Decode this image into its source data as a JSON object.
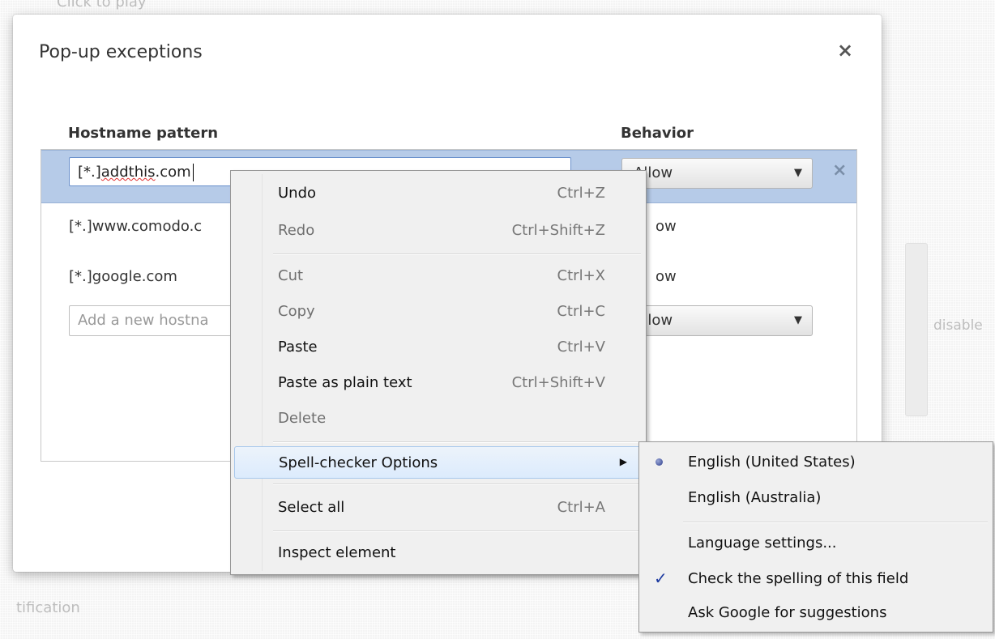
{
  "background": {
    "top_text": "Click to play",
    "bottom_text": "tification",
    "right_text": "disable"
  },
  "dialog": {
    "title": "Pop-up exceptions",
    "close_glyph": "×",
    "columns": {
      "hostname": "Hostname pattern",
      "behavior": "Behavior"
    },
    "rows": [
      {
        "hostname_prefix": "[*.]",
        "hostname_spelled": "addthis",
        "hostname_suffix": ".com",
        "behavior": "Allow"
      },
      {
        "hostname": "[*.]www.comodo.c",
        "behavior": "ow"
      },
      {
        "hostname": "[*.]google.com",
        "behavior": "ow"
      }
    ],
    "add_placeholder": "Add a new hostna",
    "add_behavior": "Allow",
    "row_remove_glyph": "×",
    "select_arrow": "▼"
  },
  "context_menu": {
    "items": [
      {
        "label": "Undo",
        "shortcut": "Ctrl+Z"
      },
      {
        "label": "Redo",
        "shortcut": "Ctrl+Shift+Z"
      },
      {
        "label": "Cut",
        "shortcut": "Ctrl+X"
      },
      {
        "label": "Copy",
        "shortcut": "Ctrl+C"
      },
      {
        "label": "Paste",
        "shortcut": "Ctrl+V"
      },
      {
        "label": "Paste as plain text",
        "shortcut": "Ctrl+Shift+V"
      },
      {
        "label": "Delete",
        "shortcut": ""
      },
      {
        "label": "Spell-checker Options",
        "submenu_arrow": "▶"
      },
      {
        "label": "Select all",
        "shortcut": "Ctrl+A"
      },
      {
        "label": "Inspect element",
        "shortcut": ""
      }
    ]
  },
  "spell_submenu": {
    "items": [
      {
        "label": "English (United States)"
      },
      {
        "label": "English (Australia)"
      },
      {
        "label": "Language settings..."
      },
      {
        "label": "Check the spelling of this field",
        "check": "✓"
      },
      {
        "label": "Ask Google for suggestions"
      }
    ]
  }
}
